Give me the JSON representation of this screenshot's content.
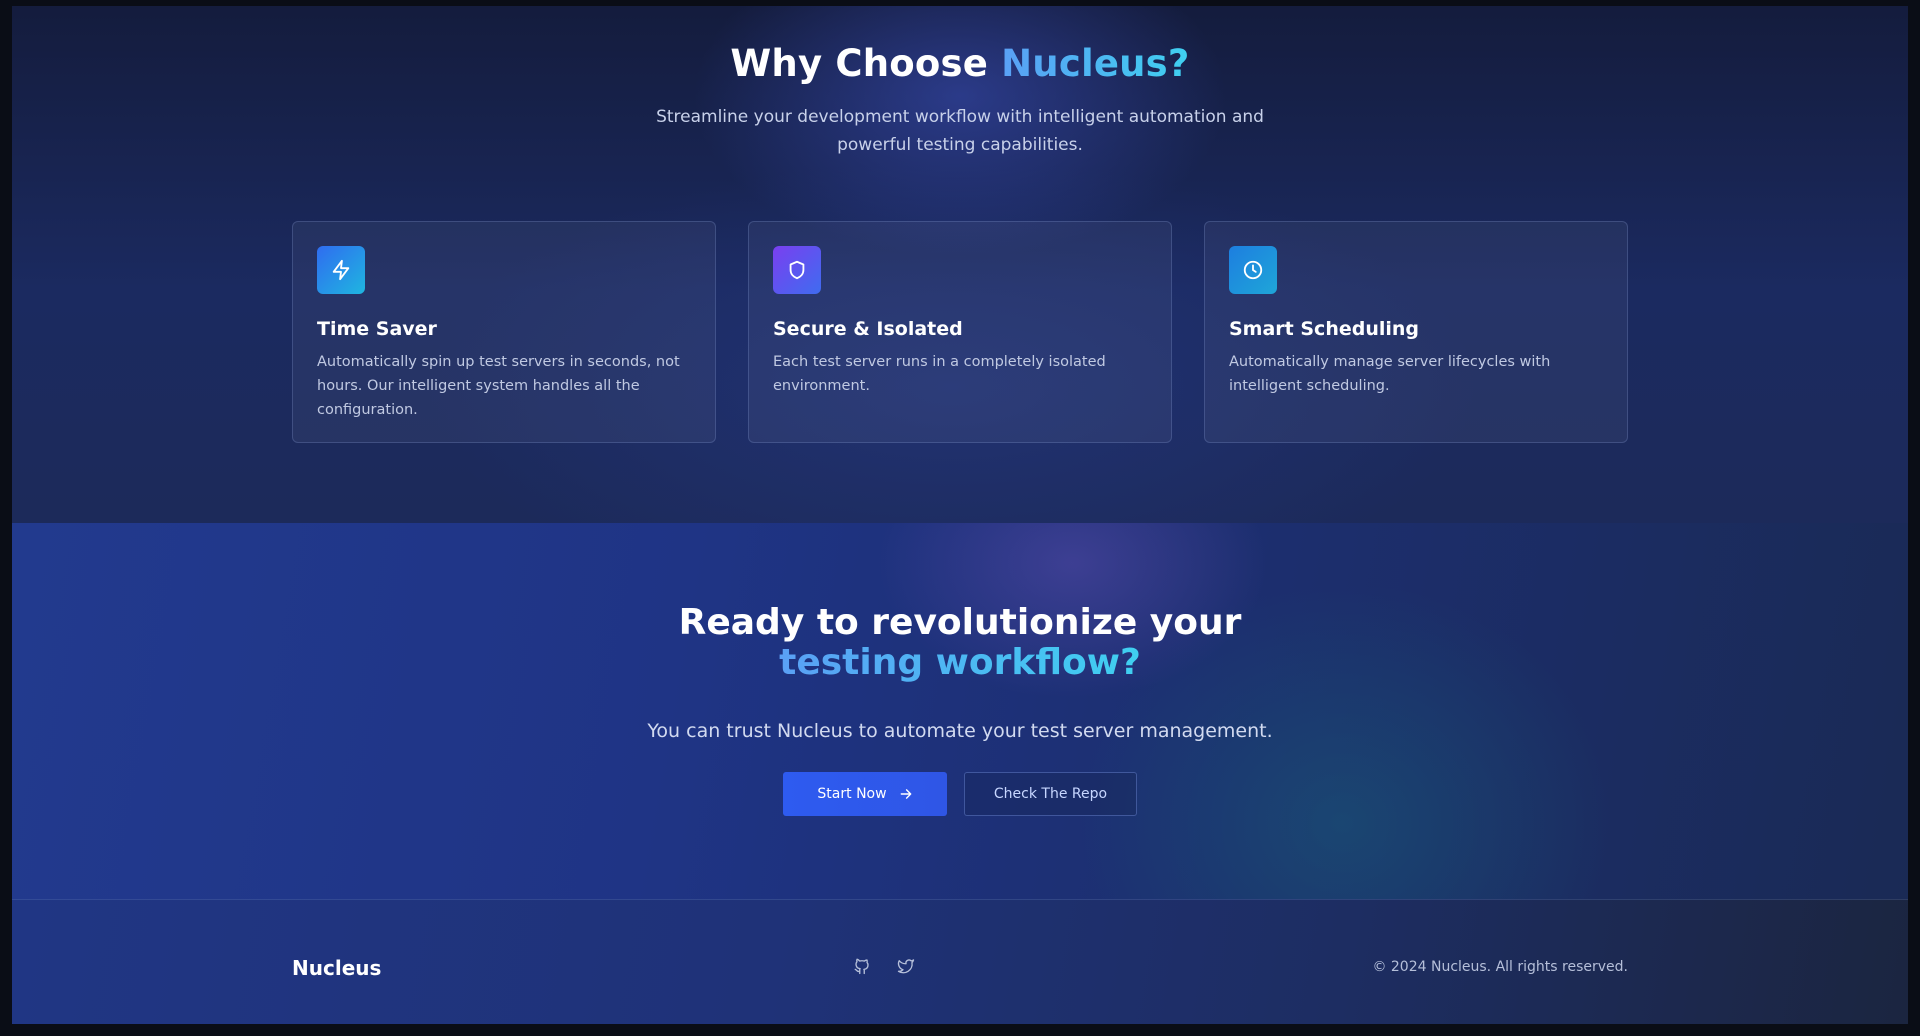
{
  "features": {
    "title_prefix": "Why Choose ",
    "title_accent": "Nucleus?",
    "subtitle": "Streamline your development workflow with intelligent automation and powerful testing capabilities.",
    "cards": [
      {
        "icon": "lightning-icon",
        "icon_gradient": [
          "#2f6cf0",
          "#1fb6e0"
        ],
        "title": "Time Saver",
        "description": "Automatically spin up test servers in seconds, not hours. Our intelligent system handles all the configuration."
      },
      {
        "icon": "shield-icon",
        "icon_gradient": [
          "#7a3ff0",
          "#3f6cf0"
        ],
        "title": "Secure & Isolated",
        "description": "Each test server runs in a completely isolated environment."
      },
      {
        "icon": "clock-icon",
        "icon_gradient": [
          "#1d7ee0",
          "#1fa6d8"
        ],
        "title": "Smart Scheduling",
        "description": "Automatically manage server lifecycles with intelligent scheduling."
      }
    ]
  },
  "cta": {
    "headline_prefix": "Ready to revolutionize your ",
    "headline_accent": "testing workflow?",
    "lead": "You can trust Nucleus to automate your test server management.",
    "primary_label": "Start Now",
    "secondary_label": "Check The Repo"
  },
  "footer": {
    "brand": "Nucleus",
    "social_icons": [
      "github-icon",
      "twitter-icon"
    ],
    "copyright": "© 2024 Nucleus. All rights reserved."
  },
  "colors": {
    "accent_start": "#5aa0f5",
    "accent_end": "#3fd0f0",
    "primary_button": "#2e5bf0"
  }
}
